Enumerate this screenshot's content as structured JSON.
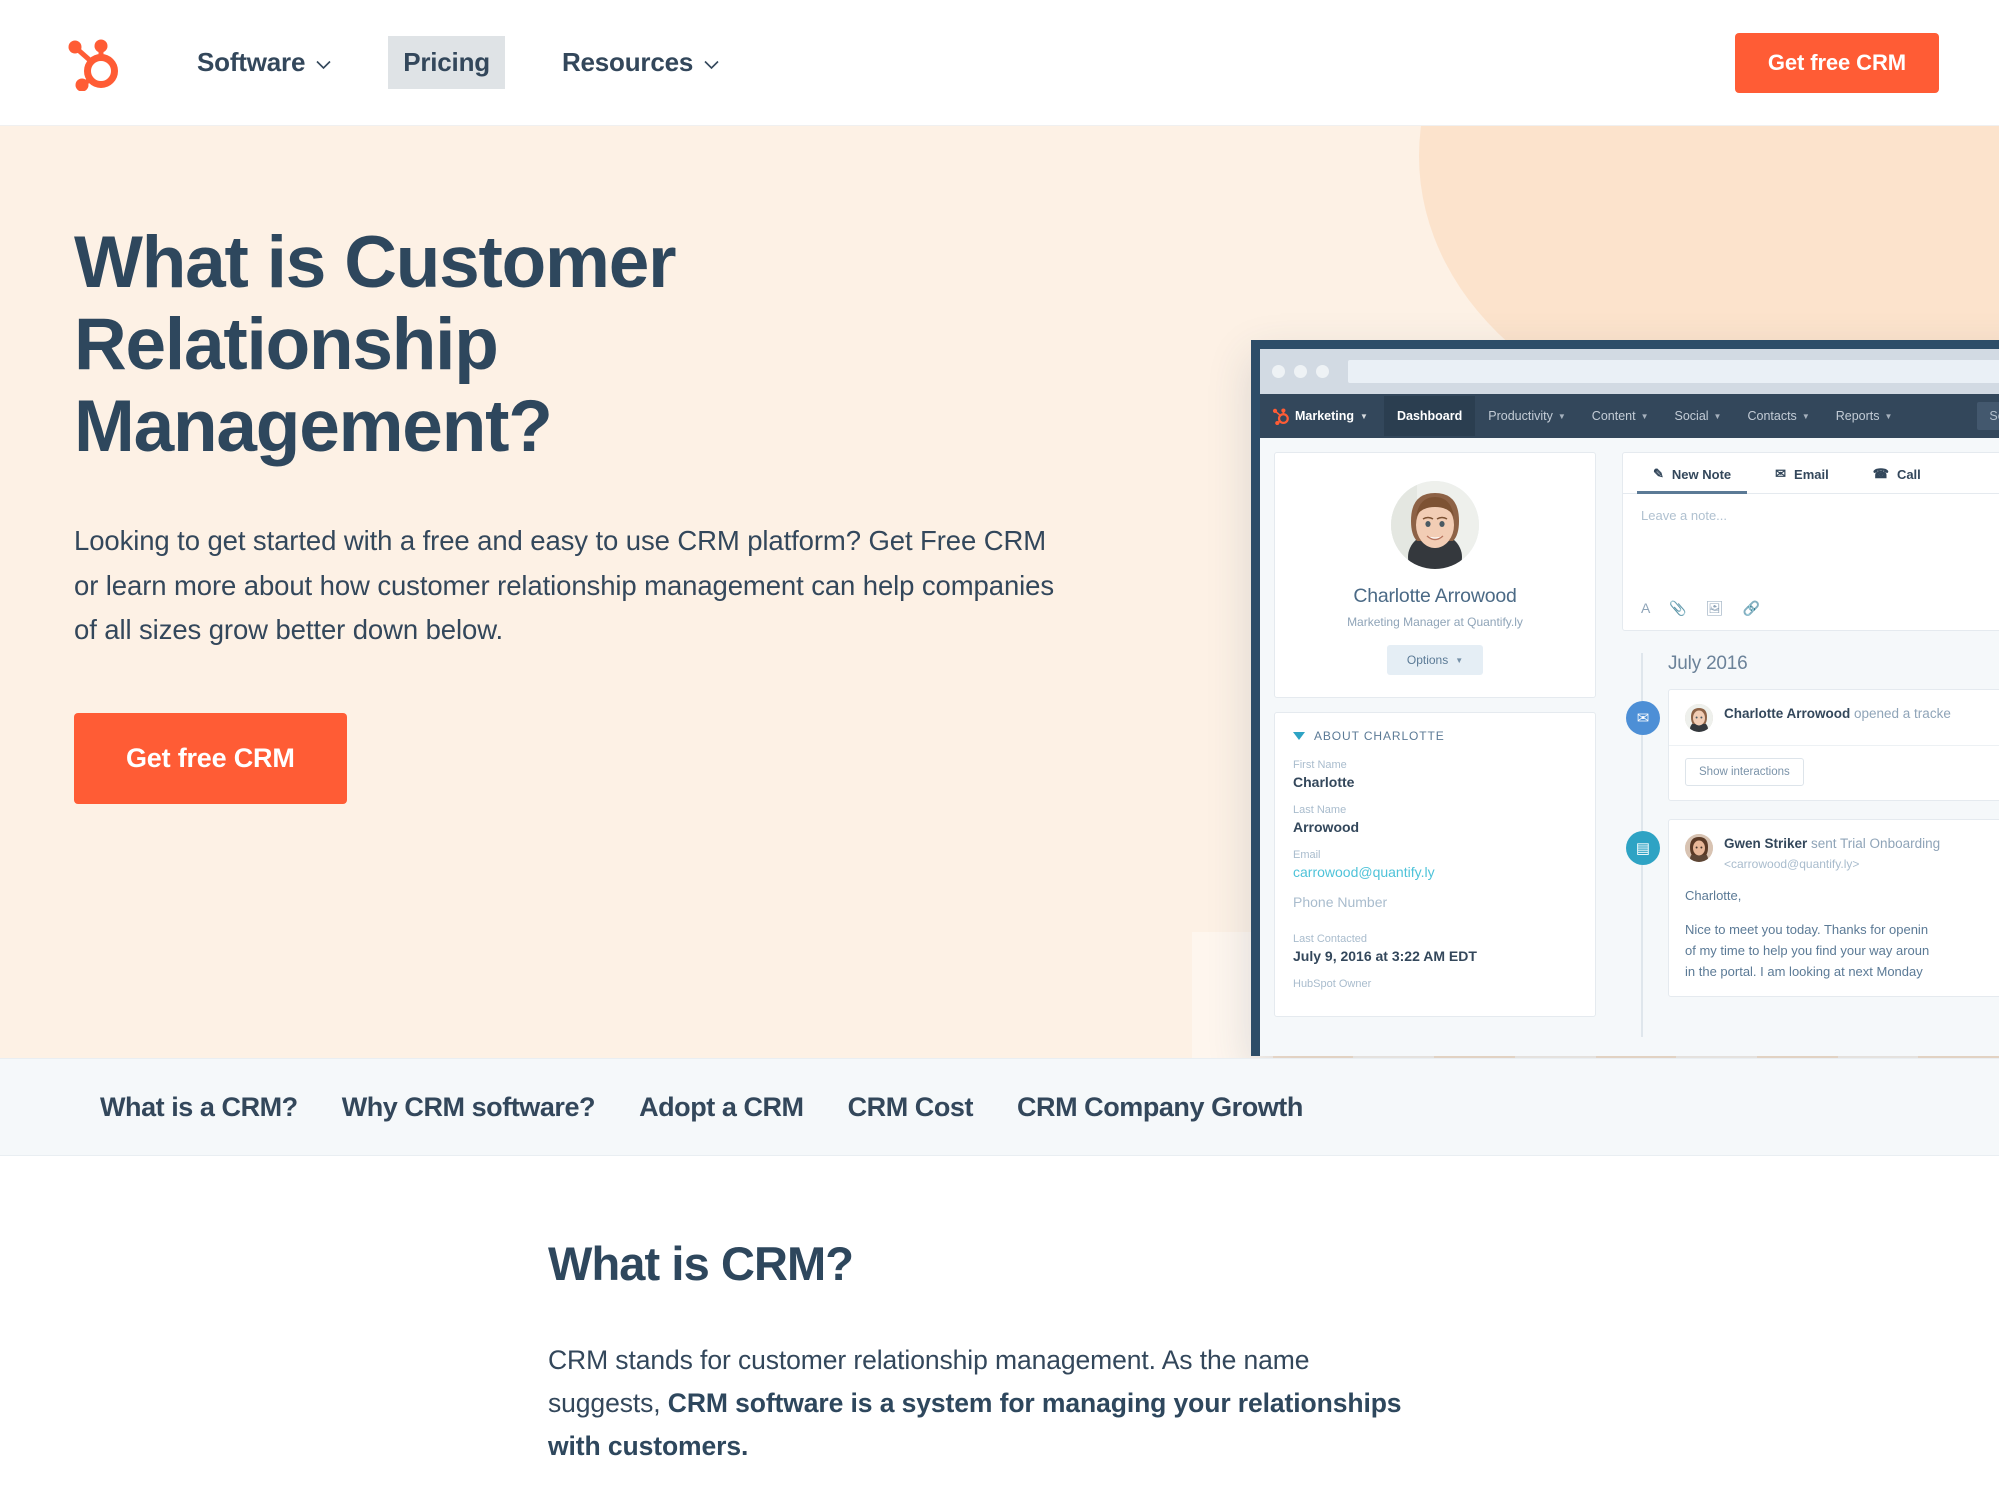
{
  "colors": {
    "brand_orange": "#ff5c35",
    "navy": "#33475b",
    "heading_navy": "#2e475d",
    "hero_bg": "#fdf1e5",
    "anchor_bg": "#f5f8fa",
    "app_navy": "#33475b",
    "teal_link": "#4fc3d9"
  },
  "topnav": {
    "logo_name": "hubspot-sprocket-logo",
    "items": [
      {
        "label": "Software",
        "has_caret": true,
        "active": false
      },
      {
        "label": "Pricing",
        "has_caret": false,
        "active": true
      },
      {
        "label": "Resources",
        "has_caret": true,
        "active": false
      }
    ],
    "cta_label": "Get free CRM"
  },
  "hero": {
    "title": "What is Customer Relationship Management?",
    "subtitle": "Looking to get started with a free and easy to use CRM platform? Get Free CRM or learn more about how customer relationship management can help companies of all sizes grow better down below.",
    "cta_label": "Get free CRM"
  },
  "screenshot": {
    "app_nav": {
      "brand": "Marketing",
      "links": [
        {
          "label": "Dashboard",
          "caret": false,
          "active": true
        },
        {
          "label": "Productivity",
          "caret": true,
          "active": false
        },
        {
          "label": "Content",
          "caret": true,
          "active": false
        },
        {
          "label": "Social",
          "caret": true,
          "active": false
        },
        {
          "label": "Contacts",
          "caret": true,
          "active": false
        },
        {
          "label": "Reports",
          "caret": true,
          "active": false
        }
      ],
      "search_label": "Search"
    },
    "contact": {
      "name": "Charlotte Arrowood",
      "role": "Marketing Manager at Quantify.ly",
      "options_label": "Options"
    },
    "about": {
      "heading": "ABOUT CHARLOTTE",
      "fields": [
        {
          "label": "First Name",
          "value": "Charlotte",
          "type": "text"
        },
        {
          "label": "Last Name",
          "value": "Arrowood",
          "type": "text"
        },
        {
          "label": "Email",
          "value": "carrowood@quantify.ly",
          "type": "link"
        },
        {
          "label": "Phone Number",
          "value": "",
          "type": "empty"
        },
        {
          "label": "Last Contacted",
          "value": "July 9, 2016 at 3:22 AM EDT",
          "type": "text"
        }
      ],
      "clipped_label": "HubSpot Owner"
    },
    "composer": {
      "tabs": [
        {
          "label": "New Note",
          "icon": "pencil-icon",
          "glyph": "✎",
          "active": true
        },
        {
          "label": "Email",
          "icon": "envelope-icon",
          "glyph": "✉",
          "active": false
        },
        {
          "label": "Call",
          "icon": "phone-icon",
          "glyph": "☎",
          "active": false
        }
      ],
      "placeholder": "Leave a note...",
      "tools": [
        {
          "icon": "text-format-icon",
          "glyph": "A"
        },
        {
          "icon": "paperclip-icon",
          "glyph": "📎"
        },
        {
          "icon": "image-icon",
          "glyph": "🖼"
        },
        {
          "icon": "link-icon",
          "glyph": "🔗"
        }
      ]
    },
    "timeline": {
      "month": "July 2016",
      "events": [
        {
          "icon": "envelope-icon",
          "glyph": "✉",
          "actor": "Charlotte Arrowood",
          "text": " opened a tracke",
          "button": "Show interactions"
        },
        {
          "icon": "document-icon",
          "glyph": "▤",
          "actor": "Gwen Striker",
          "text": " sent Trial Onboarding",
          "sub": "<carrowood@quantify.ly>",
          "body": [
            "Charlotte,",
            "Nice to meet you today.  Thanks for openin",
            "of my time to help you find your way aroun",
            "in the portal.  I am looking at next Monday"
          ]
        }
      ]
    }
  },
  "anchor_nav": {
    "links": [
      "What is a CRM?",
      "Why CRM software?",
      "Adopt a CRM",
      "CRM Cost",
      "CRM Company Growth"
    ]
  },
  "main": {
    "title": "What is CRM?",
    "body_lead": "CRM stands for customer relationship management. As the name suggests, ",
    "body_bold": "CRM software is a system for managing your relationships with customers."
  }
}
